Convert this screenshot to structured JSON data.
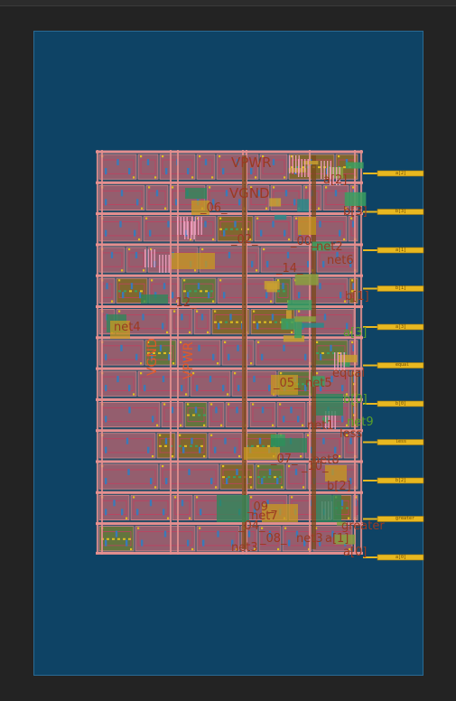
{
  "viewer": {
    "background": "#232323",
    "die_fill": "#0e4365",
    "die_border": "#2a6a93"
  },
  "colors": {
    "rail": "#e58f8f",
    "cell_fill": "#a06070",
    "poly": "#c04060",
    "metal1": "#3a7ab8",
    "metal2": "#c8a030",
    "via": "#e0c020",
    "diff": "#3aa060",
    "pin": "#e8b820",
    "label": "#9a3a22",
    "label_green": "#5aa028"
  },
  "layout": {
    "rows": 13,
    "supply_labels": {
      "vpwr": "VPWR",
      "vgnd": "VGND"
    },
    "vertical_supply": {
      "vgnd": "VGND",
      "vpwr": "VPWR"
    },
    "net_labels": [
      {
        "text": "a[2]"
      },
      {
        "text": "_06_"
      },
      {
        "text": "b[3]"
      },
      {
        "text": "_02_"
      },
      {
        "text": "_00_"
      },
      {
        "text": "net2"
      },
      {
        "text": "net6"
      },
      {
        "text": "_14_"
      },
      {
        "text": "b[1]"
      },
      {
        "text": "_12_"
      },
      {
        "text": "net4"
      },
      {
        "text": "a[3]"
      },
      {
        "text": "equal"
      },
      {
        "text": "_05_"
      },
      {
        "text": "net5"
      },
      {
        "text": "b[0]"
      },
      {
        "text": "net9"
      },
      {
        "text": "net1"
      },
      {
        "text": "less"
      },
      {
        "text": "net8"
      },
      {
        "text": "_07_"
      },
      {
        "text": "_10_"
      },
      {
        "text": "b[2]"
      },
      {
        "text": "_09_"
      },
      {
        "text": "net7"
      },
      {
        "text": "_04_"
      },
      {
        "text": "greater"
      },
      {
        "text": "_08_"
      },
      {
        "text": "net3"
      },
      {
        "text": "net3"
      },
      {
        "text": "a[1]"
      },
      {
        "text": "a[0]"
      }
    ],
    "pins": [
      {
        "name": "a[2]"
      },
      {
        "name": "b[3]"
      },
      {
        "name": "a[1]"
      },
      {
        "name": "b[1]"
      },
      {
        "name": "a[3]"
      },
      {
        "name": "equal"
      },
      {
        "name": "b[0]"
      },
      {
        "name": "less"
      },
      {
        "name": "b[2]"
      },
      {
        "name": "greater"
      },
      {
        "name": "a[0]"
      }
    ]
  }
}
